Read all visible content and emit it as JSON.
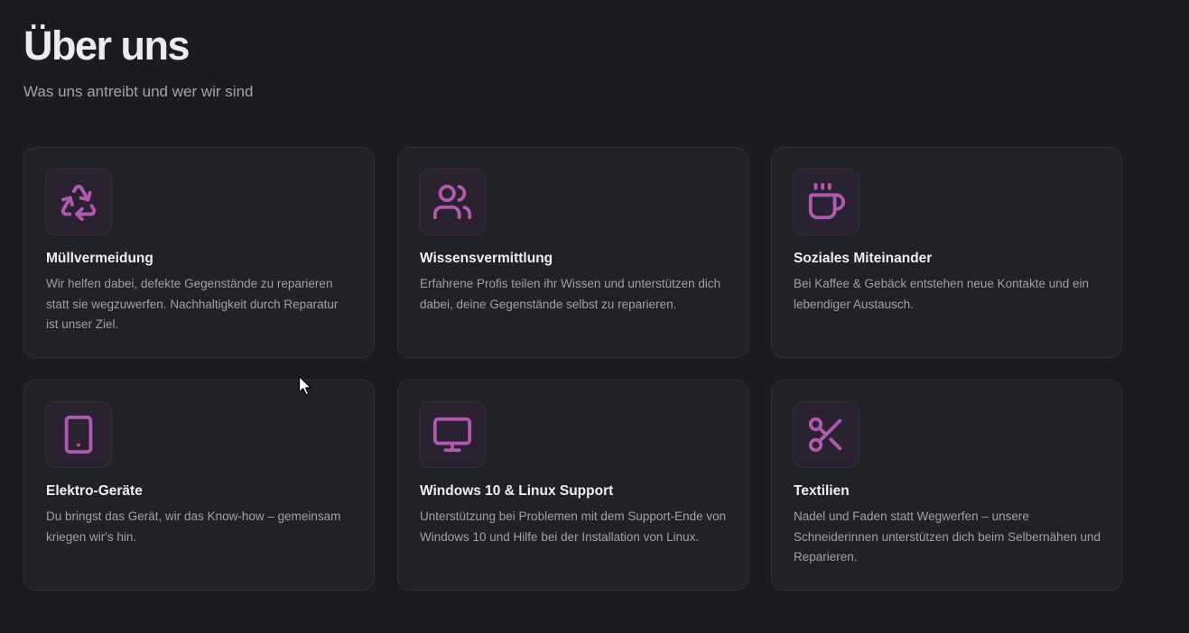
{
  "header": {
    "title": "Über uns",
    "subtitle": "Was uns antreibt und wer wir sind"
  },
  "colors": {
    "background": "#1a1c21",
    "card": "#202227",
    "accent": "#b05aad"
  },
  "cards": [
    {
      "icon": "recycle-icon",
      "title": "Müllvermeidung",
      "text": "Wir helfen dabei, defekte Gegenstände zu reparieren statt sie wegzuwerfen. Nachhaltigkeit durch Reparatur ist unser Ziel."
    },
    {
      "icon": "users-icon",
      "title": "Wissensvermittlung",
      "text": "Erfahrene Profis teilen ihr Wissen und unterstützen dich dabei, deine Gegenstände selbst zu reparieren."
    },
    {
      "icon": "coffee-cup-icon",
      "title": "Soziales Miteinander",
      "text": "Bei Kaffee & Gebäck entstehen neue Kontakte und ein lebendiger Austausch."
    },
    {
      "icon": "tablet-icon",
      "title": "Elektro-Geräte",
      "text": "Du bringst das Gerät, wir das Know-how – gemeinsam kriegen wir's hin."
    },
    {
      "icon": "monitor-icon",
      "title": "Windows 10 & Linux Support",
      "text": "Unterstützung bei Problemen mit dem Support-Ende von Windows 10 und Hilfe bei der Installation von Linux."
    },
    {
      "icon": "scissors-icon",
      "title": "Textilien",
      "text": "Nadel und Faden statt Wegwerfen – unsere Schneiderinnen unterstützen dich beim Selbernähen und Reparieren."
    }
  ]
}
